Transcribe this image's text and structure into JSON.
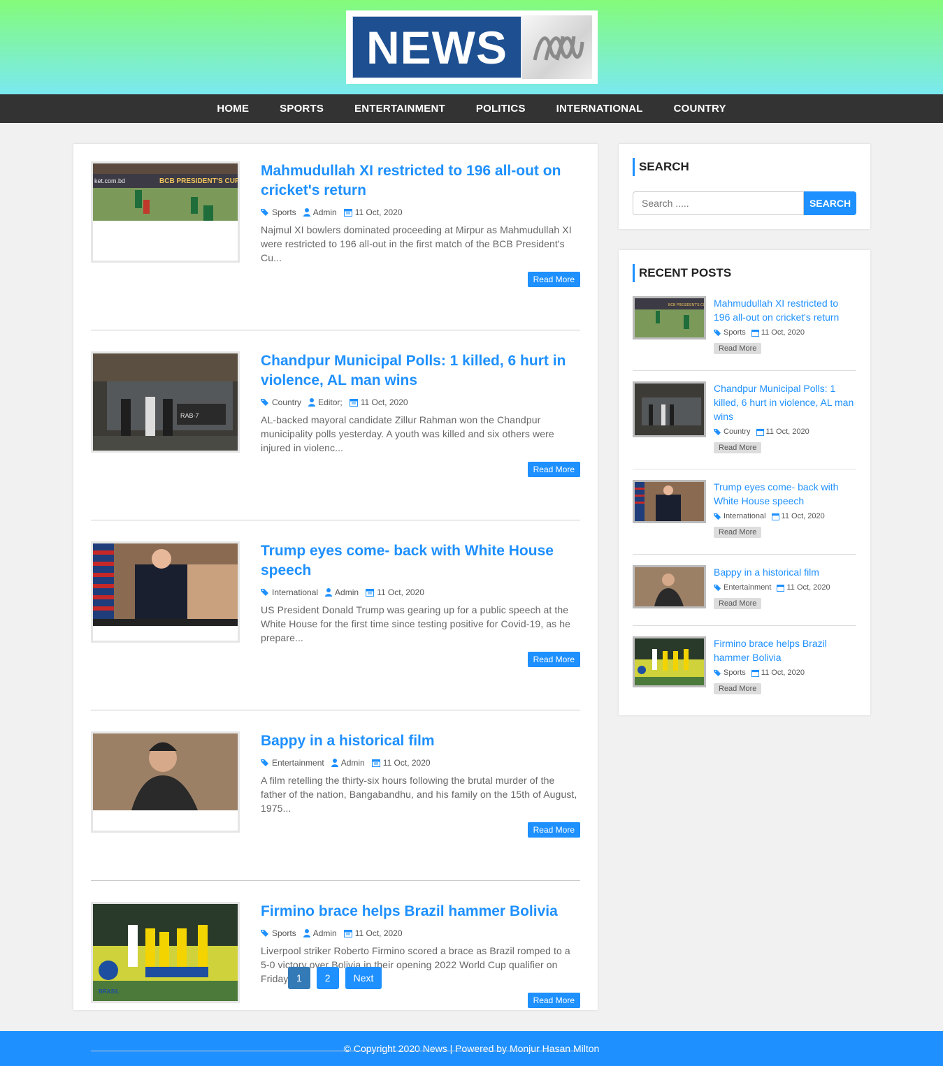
{
  "brand": {
    "logo_text": "NEWS"
  },
  "nav": [
    "HOME",
    "SPORTS",
    "ENTERTAINMENT",
    "POLITICS",
    "INTERNATIONAL",
    "COUNTRY"
  ],
  "posts": [
    {
      "title": "Mahmudullah XI restricted to 196 all-out on cricket's return",
      "category": "Sports",
      "author": "Admin",
      "date": "11 Oct, 2020",
      "excerpt": "Najmul XI bowlers dominated proceeding at Mirpur as Mahmudullah XI were restricted to 196 all-out in the first match of the BCB President's Cu...",
      "read_more": "Read More"
    },
    {
      "title": "Chandpur Municipal Polls: 1 killed, 6 hurt in violence, AL man wins",
      "category": "Country",
      "author": "Editor;",
      "date": "11 Oct, 2020",
      "excerpt": "AL-backed mayoral candidate Zillur Rahman won the Chandpur municipality polls yesterday. A youth was killed and six others were injured in violenc...",
      "read_more": "Read More"
    },
    {
      "title": "Trump eyes come- back with White House speech",
      "category": "International",
      "author": "Admin",
      "date": "11 Oct, 2020",
      "excerpt": "US President Donald Trump was gearing up for a public speech at the White House for the first time since testing positive for Covid-19, as he prepare...",
      "read_more": "Read More"
    },
    {
      "title": "Bappy in a historical film",
      "category": "Entertainment",
      "author": "Admin",
      "date": "11 Oct, 2020",
      "excerpt": "A film retelling the thirty-six hours following the brutal murder of the father of the nation, Bangabandhu, and his family on the 15th of August, 1975...",
      "read_more": "Read More"
    },
    {
      "title": "Firmino brace helps Brazil hammer Bolivia",
      "category": "Sports",
      "author": "Admin",
      "date": "11 Oct, 2020",
      "excerpt": "Liverpool striker Roberto Firmino scored a brace as Brazil romped to a 5-0 victory over Bolivia in their opening 2022 World Cup qualifier on Friday....",
      "read_more": "Read More"
    }
  ],
  "pagination": {
    "pages": [
      "1",
      "2"
    ],
    "next": "Next"
  },
  "search": {
    "title": "SEARCH",
    "placeholder": "Search .....",
    "button": "SEARCH"
  },
  "recent": {
    "title": "RECENT POSTS",
    "items": [
      {
        "title": "Mahmudullah XI restricted to 196 all-out on cricket's return",
        "category": "Sports",
        "date": "11 Oct, 2020",
        "read_more": "Read More"
      },
      {
        "title": "Chandpur Municipal Polls: 1 killed, 6 hurt in violence, AL man wins",
        "category": "Country",
        "date": "11 Oct, 2020",
        "read_more": "Read More"
      },
      {
        "title": "Trump eyes come- back with White House speech",
        "category": "International",
        "date": "11 Oct, 2020",
        "read_more": "Read More"
      },
      {
        "title": "Bappy in a historical film",
        "category": "Entertainment",
        "date": "11 Oct, 2020",
        "read_more": "Read More"
      },
      {
        "title": "Firmino brace helps Brazil hammer Bolivia",
        "category": "Sports",
        "date": "11 Oct, 2020",
        "read_more": "Read More"
      }
    ]
  },
  "footer": {
    "text": "© Copyright 2020 News | Powered by Monjur Hasan Milton"
  },
  "colors": {
    "accent": "#1e90ff",
    "nav_bg": "#333333",
    "header_top": "#84fb7a",
    "header_bottom": "#7ae9f0"
  }
}
